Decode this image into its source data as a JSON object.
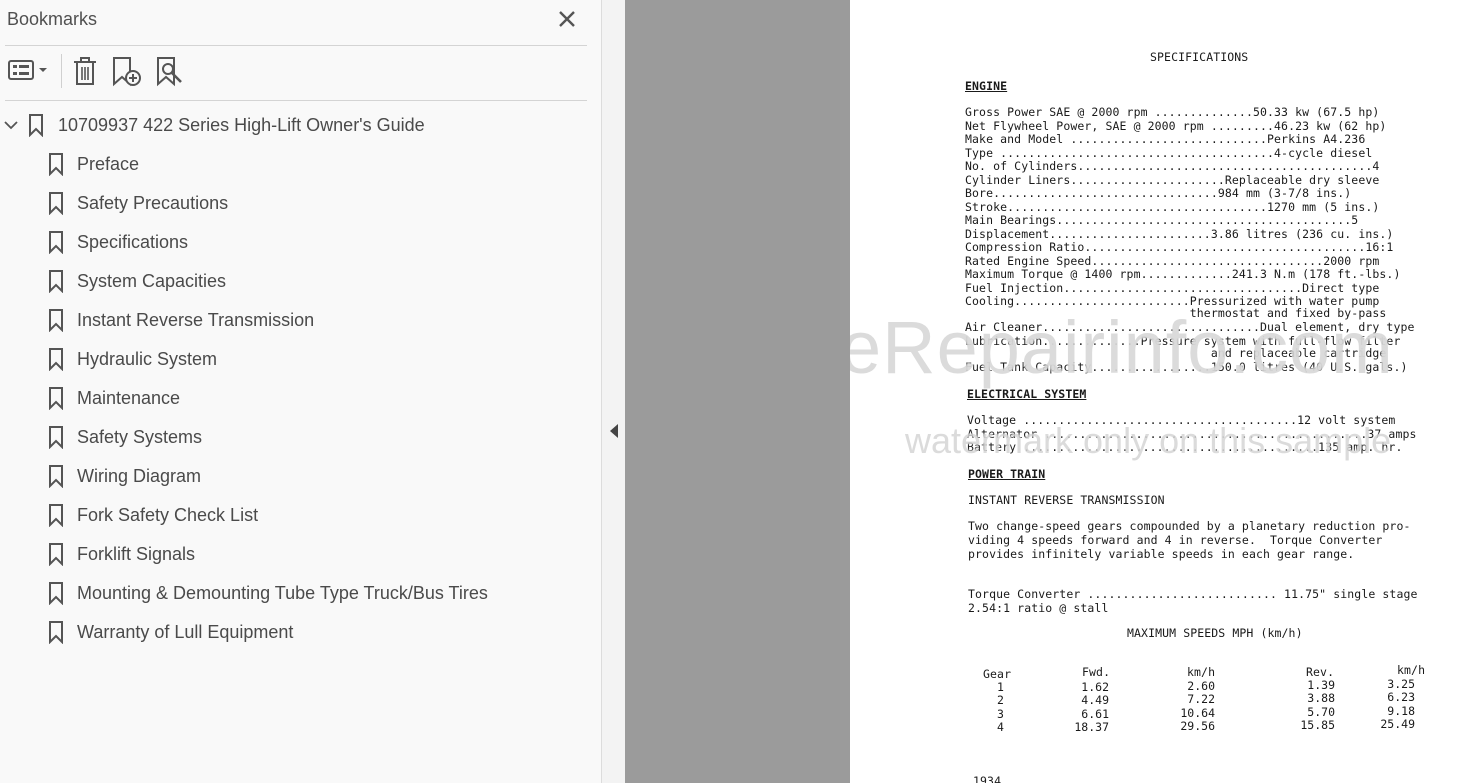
{
  "panel": {
    "title": "Bookmarks",
    "root_label": "10709937 422 Series High-Lift Owner's Guide",
    "items": [
      "Preface",
      "Safety Precautions",
      "Specifications",
      "System Capacities",
      "Instant Reverse Transmission",
      "Hydraulic System",
      "Maintenance",
      "Safety Systems",
      "Wiring Diagram",
      "Fork Safety Check List",
      "Forklift Signals",
      "Mounting & Demounting Tube Type Truck/Bus Tires",
      "Warranty of Lull Equipment"
    ],
    "toolbar_icons": [
      "options-menu-icon",
      "delete-bookmark-icon",
      "new-bookmark-icon",
      "find-bookmark-icon"
    ]
  },
  "colors": {
    "viewer_bg": "#9b9b9b",
    "panel_bg": "#f9f9f9",
    "text": "#4a4a4a"
  },
  "document": {
    "title": "SPECIFICATIONS",
    "engine_heading": "ENGINE",
    "engine_lines": [
      "Gross Power SAE @ 2000 rpm ..............50.33 kw (67.5 hp)",
      "Net Flywheel Power, SAE @ 2000 rpm .........46.23 kw (62 hp)",
      "Make and Model ............................Perkins A4.236",
      "Type .......................................4-cycle diesel",
      "No. of Cylinders..........................................4",
      "Cylinder Liners......................Replaceable dry sleeve",
      "Bore................................984 mm (3-7/8 ins.)",
      "Stroke.....................................1270 mm (5 ins.)",
      "Main Bearings..........................................5",
      "Displacement.......................3.86 litres (236 cu. ins.)",
      "Compression Ratio........................................16:1",
      "Rated Engine Speed.................................2000 rpm",
      "Maximum Torque @ 1400 rpm.............241.3 N.m (178 ft.-lbs.)",
      "Fuel Injection..................................Direct type",
      "Cooling.........................Pressurized with water pump",
      "                                thermostat and fixed by-pass",
      "Air Cleaner...............................Dual element, dry type",
      "Lubrication..............Pressure system with full-flow filter",
      "                                   and replaceable cartridge",
      "Fuel Tank Capacity.................150.0 litres (40 U.S. gals.)"
    ],
    "electrical_heading": "ELECTRICAL SYSTEM",
    "electrical_lines": [
      "Voltage .......................................12 volt system",
      "Alternator ..............................................37 amps",
      "Battery ..........................................135 amp. hr."
    ],
    "power_heading": "POWER TRAIN",
    "transmission_heading": "INSTANT REVERSE TRANSMISSION",
    "transmission_text": [
      "Two change-speed gears compounded by a planetary reduction pro-",
      "viding 4 speeds forward and 4 in reverse.  Torque Converter",
      "provides infinitely variable speeds in each gear range."
    ],
    "torque_lines": [
      "Torque Converter ........................... 11.75\" single stage",
      "2.54:1 ratio @ stall"
    ],
    "speeds_title": "MAXIMUM SPEEDS MPH (km/h)",
    "speed_headers": [
      "Gear",
      "Fwd.",
      "km/h",
      "Rev.",
      "km/h"
    ],
    "speed_rows": [
      [
        "1",
        "1.62",
        "2.60",
        "1.39",
        "3.25"
      ],
      [
        "2",
        "4.49",
        "7.22",
        "3.88",
        "6.23"
      ],
      [
        "3",
        "6.61",
        "10.64",
        "5.70",
        "9.18"
      ],
      [
        "4",
        "18.37",
        "29.56",
        "15.85",
        "25.49"
      ]
    ],
    "footer_partial": "1934",
    "watermark_main": "eRepairinfo.com",
    "watermark_sub": "watermark only on this sample"
  }
}
